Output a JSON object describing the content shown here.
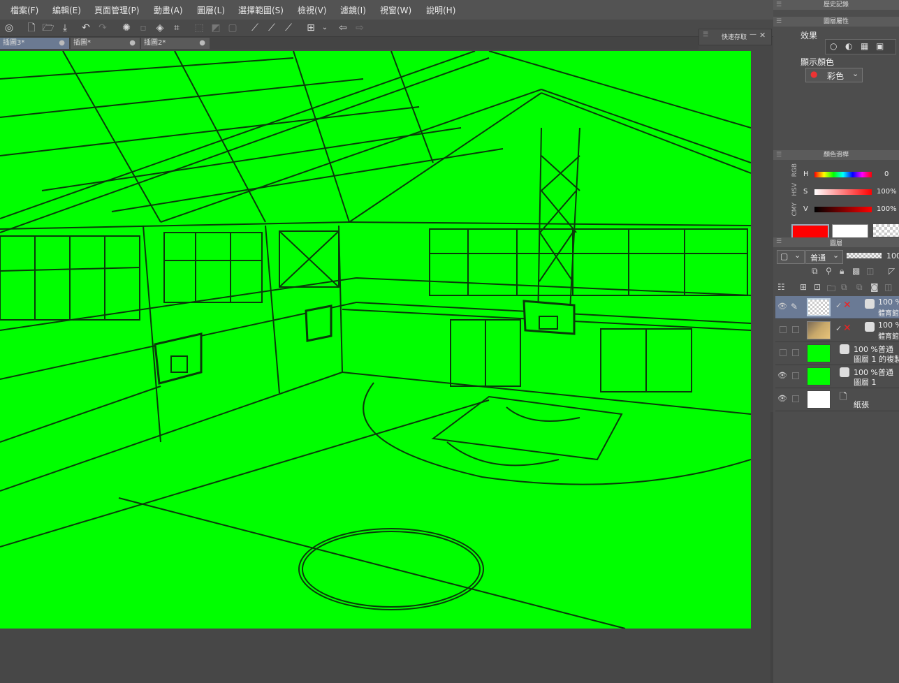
{
  "menu": {
    "items": [
      "檔案(F)",
      "編輯(E)",
      "頁面管理(P)",
      "動畫(A)",
      "圖層(L)",
      "選擇範圍(S)",
      "檢視(V)",
      "濾鏡(I)",
      "視窗(W)",
      "說明(H)"
    ]
  },
  "tabs": [
    {
      "label": "插圖3*",
      "active": true
    },
    {
      "label": "插圖*",
      "active": false
    },
    {
      "label": "插圖2*",
      "active": false
    }
  ],
  "quick_save": {
    "title": "快速存取"
  },
  "panels": {
    "history_title": "歷史記錄",
    "layer_property": {
      "title": "圖層屬性",
      "effect_label": "效果",
      "display_color_label": "顯示顏色",
      "display_color_value": "彩色"
    },
    "color_slider": {
      "title": "顏色滑桿",
      "modes": [
        "RGB",
        "HSV",
        "CMY"
      ],
      "h_label": "H",
      "h_value": "0",
      "s_label": "S",
      "s_value": "100%",
      "v_label": "V",
      "v_value": "100%",
      "main_color": "#ff0000",
      "sub_color": "#ffffff"
    },
    "layers": {
      "title": "圖層",
      "blend_mode": "普通",
      "opacity": "100",
      "rows": [
        {
          "line1": "100 %",
          "line2": "體育館",
          "thumb": "checker",
          "selected": true
        },
        {
          "line1": "100 %",
          "line2": "體育館",
          "thumb": "photo",
          "selected": false
        },
        {
          "line1": "100 %普通",
          "line2": "圖層 1 的複製",
          "thumb": "green",
          "selected": false
        },
        {
          "line1": "100 %普通",
          "line2": "圖層 1",
          "thumb": "green",
          "selected": false
        },
        {
          "line1": "",
          "line2": "紙張",
          "thumb": "white",
          "selected": false
        }
      ]
    }
  },
  "colors": {
    "canvas_fill": "#00ff00",
    "line_color": "#0a3a0a"
  }
}
